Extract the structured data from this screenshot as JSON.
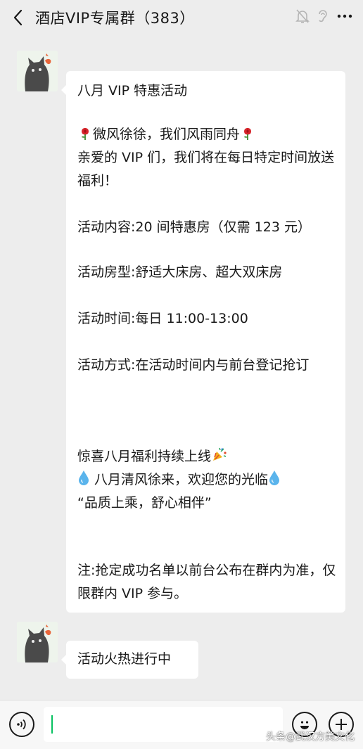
{
  "header": {
    "title": "酒店VIP专属群（383）",
    "icons": [
      "back-chevron-icon",
      "mute-bell-icon",
      "ear-icon",
      "more-icon"
    ]
  },
  "messages": [
    {
      "sender_icon": "cat-avatar",
      "paragraphs": {
        "p1": "八月 VIP 特惠活动",
        "p2a": "微风徐徐，我们风雨同舟",
        "p2b": "亲爱的 VIP 们，我们将在每日特定时间放送福利！",
        "p3": "活动内容:20 间特惠房（仅需 123 元）",
        "p4": "活动房型:舒适大床房、超大双床房",
        "p5": "活动时间:每日 11:00-13:00",
        "p6": "活动方式:在活动时间内与前台登记抢订",
        "p7": "惊喜八月福利持续上线",
        "p8": "八月清风徐来，欢迎您的光临",
        "p9": "“品质上乘，舒心相伴”",
        "p10": "注:抢定成功名单以前台公布在群内为准，仅限群内 VIP 参与。"
      }
    },
    {
      "sender_icon": "cat-avatar",
      "text": "活动火热进行中"
    }
  ],
  "input": {
    "value": ""
  },
  "watermark": "头条@武汉方美文化",
  "colors": {
    "background": "#ededed",
    "bubble": "#ffffff",
    "caret": "#07c160"
  }
}
